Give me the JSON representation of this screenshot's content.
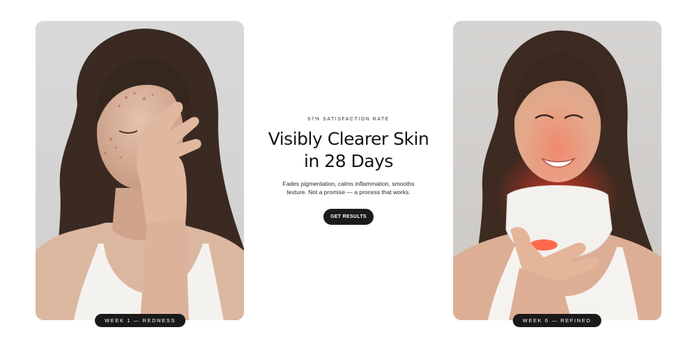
{
  "before": {
    "badge_label": "WEEK 1 — REDNESS"
  },
  "after": {
    "badge_label": "WEEK 6 — REFINED"
  },
  "hero": {
    "eyebrow": "97% SATISFACTION RATE",
    "headline_line1": "Visibly Clearer Skin",
    "headline_line2": "in 28 Days",
    "subtext_line1": "Fades pigmentation, calms inflammation, smooths",
    "subtext_line2": "texture. Not a promise — a process that works.",
    "cta_label": "GET RESULTS"
  },
  "colors": {
    "badge_bg": "#1a1a1a",
    "cta_bg": "#1b1b1b",
    "text": "#141414",
    "led_red": "#ff3a2a"
  }
}
